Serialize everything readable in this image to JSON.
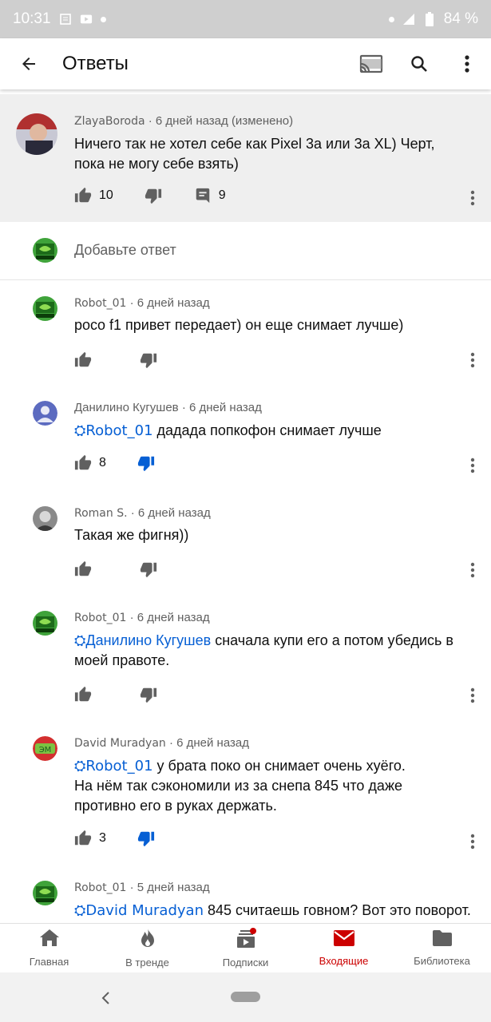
{
  "status_bar": {
    "time": "10:31",
    "battery": "84 %"
  },
  "app_bar": {
    "title": "Ответы",
    "cast_icon": "cast-icon",
    "search_icon": "search-icon",
    "menu_icon": "more-vert-icon"
  },
  "parent_comment": {
    "author": "ZlayaBoroda",
    "meta": " · 6 дней назад (изменено)",
    "text_line1": "Ничего так не хотел себе как Pixel 3a или 3a XL) Черт,",
    "text_line2": "пока не могу себе взять)",
    "likes": "10",
    "replies": "9"
  },
  "add_reply": {
    "placeholder": "Добавьте ответ"
  },
  "replies": [
    {
      "author": "Robot_01",
      "meta": " · 6 дней назад",
      "mention": "",
      "lines": [
        "poco f1 привет передает) он еще снимает лучше)"
      ],
      "likes": ""
    },
    {
      "author": "Данилино Кугушев",
      "meta": " · 6 дней назад",
      "mention": "Robot_01",
      "lines": [
        " дадада попкофон снимает лучше"
      ],
      "likes": "8"
    },
    {
      "author": "Roman S.",
      "meta": " · 6 дней назад",
      "mention": "",
      "lines": [
        "Такая же фигня))"
      ],
      "likes": ""
    },
    {
      "author": "Robot_01",
      "meta": " · 6 дней назад",
      "mention": "Данилино Кугушев",
      "lines": [
        " сначала купи его а потом убедись в",
        "моей правоте."
      ],
      "likes": ""
    },
    {
      "author": "David Muradyan",
      "meta": " · 6 дней назад",
      "mention": "Robot_01",
      "lines": [
        " у брата поко он снимает очень хуёго.",
        "На нём так сэкономили из за снепа 845 что даже",
        "противно его в руках держать."
      ],
      "likes": "3"
    },
    {
      "author": "Robot_01",
      "meta": " · 5 дней назад",
      "mention": "David Muradyan",
      "lines": [
        " 845 считаешь говном? Вот это поворот."
      ],
      "likes": ""
    }
  ],
  "bottom_nav": [
    {
      "label": "Главная",
      "icon": "home-icon"
    },
    {
      "label": "В тренде",
      "icon": "trending-icon"
    },
    {
      "label": "Подписки",
      "icon": "subscriptions-icon"
    },
    {
      "label": "Входящие",
      "icon": "inbox-icon"
    },
    {
      "label": "Библиотека",
      "icon": "library-icon"
    }
  ],
  "colors": {
    "accent_red": "#cc0000",
    "mention_blue": "#065fd4",
    "dislike_active": "#065fd4"
  }
}
